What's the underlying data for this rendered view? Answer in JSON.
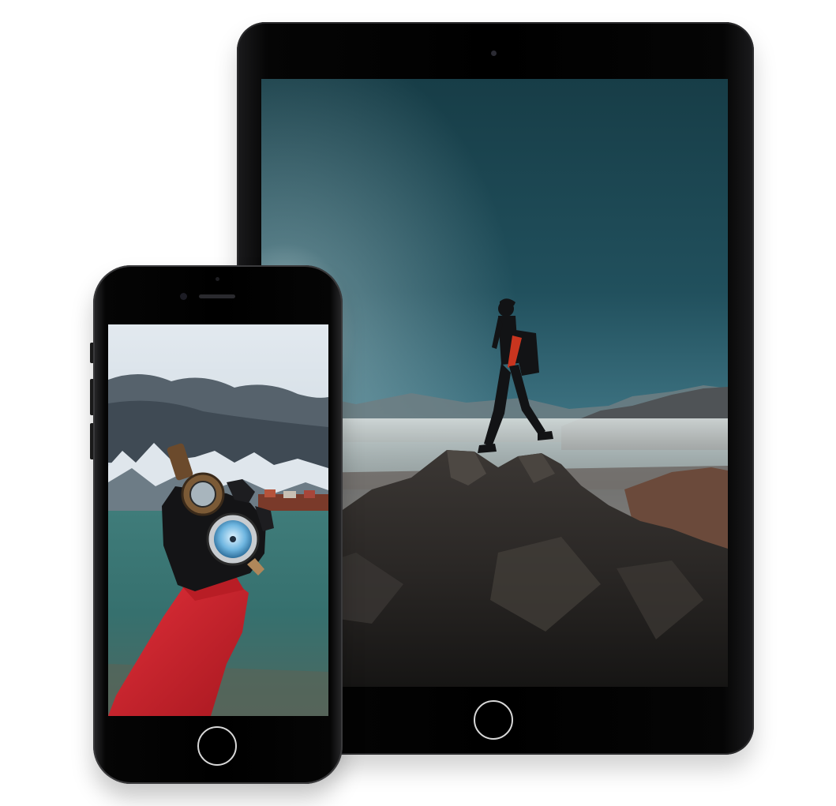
{
  "scene": {
    "background_color": "#ffffff",
    "device_color": "#000000",
    "home_button_ring_color": "#d8d8d8"
  },
  "ipad": {
    "device": "tablet",
    "wallpaper": "hiker-on-mountain-peak-photo",
    "sky_colors": [
      "#1f4d58",
      "#3f7585",
      "#9fb8bf"
    ]
  },
  "iphone": {
    "device": "phone",
    "wallpaper": "hand-holding-compass-photo",
    "water_color": "#3f7c7a",
    "sleeve_color": "#d2212a"
  }
}
